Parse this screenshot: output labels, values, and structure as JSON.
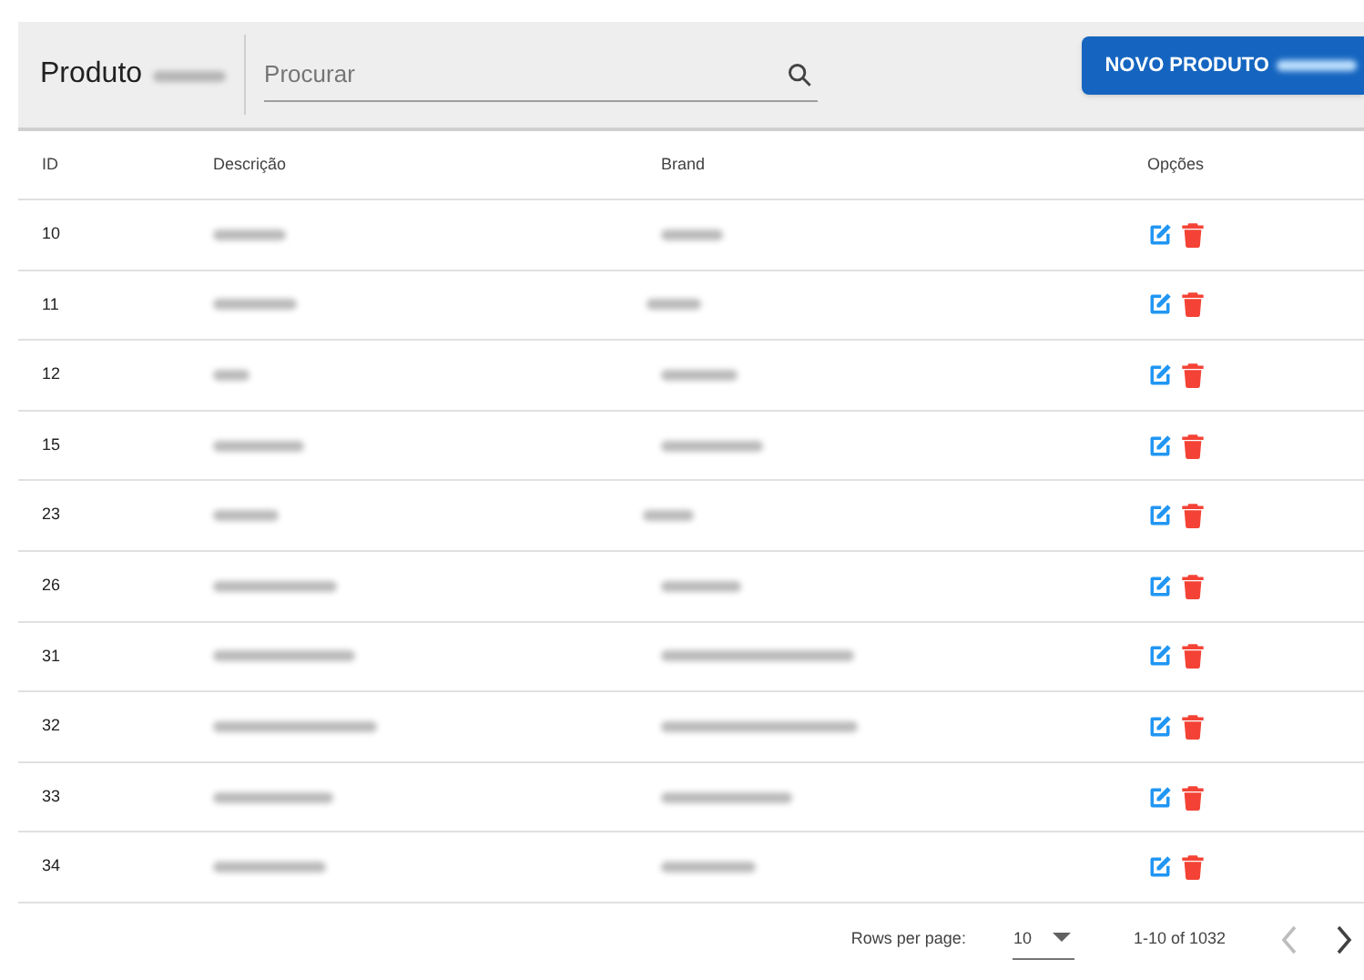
{
  "toolbar": {
    "title": "Produto",
    "search": {
      "placeholder": "Procurar"
    },
    "new_button": "NOVO PRODUTO"
  },
  "table": {
    "columns": [
      "ID",
      "Descrição",
      "Brand",
      "Opções"
    ],
    "rows": [
      {
        "id": "10"
      },
      {
        "id": "11"
      },
      {
        "id": "12"
      },
      {
        "id": "15"
      },
      {
        "id": "23"
      },
      {
        "id": "26"
      },
      {
        "id": "31"
      },
      {
        "id": "32"
      },
      {
        "id": "33"
      },
      {
        "id": "34"
      }
    ]
  },
  "pagination": {
    "rows_per_page_label": "Rows per page:",
    "rows_per_page": "10",
    "range": "1-10 of 1032",
    "previous": {
      "disabled": true
    },
    "next": {
      "disabled": false
    }
  }
}
